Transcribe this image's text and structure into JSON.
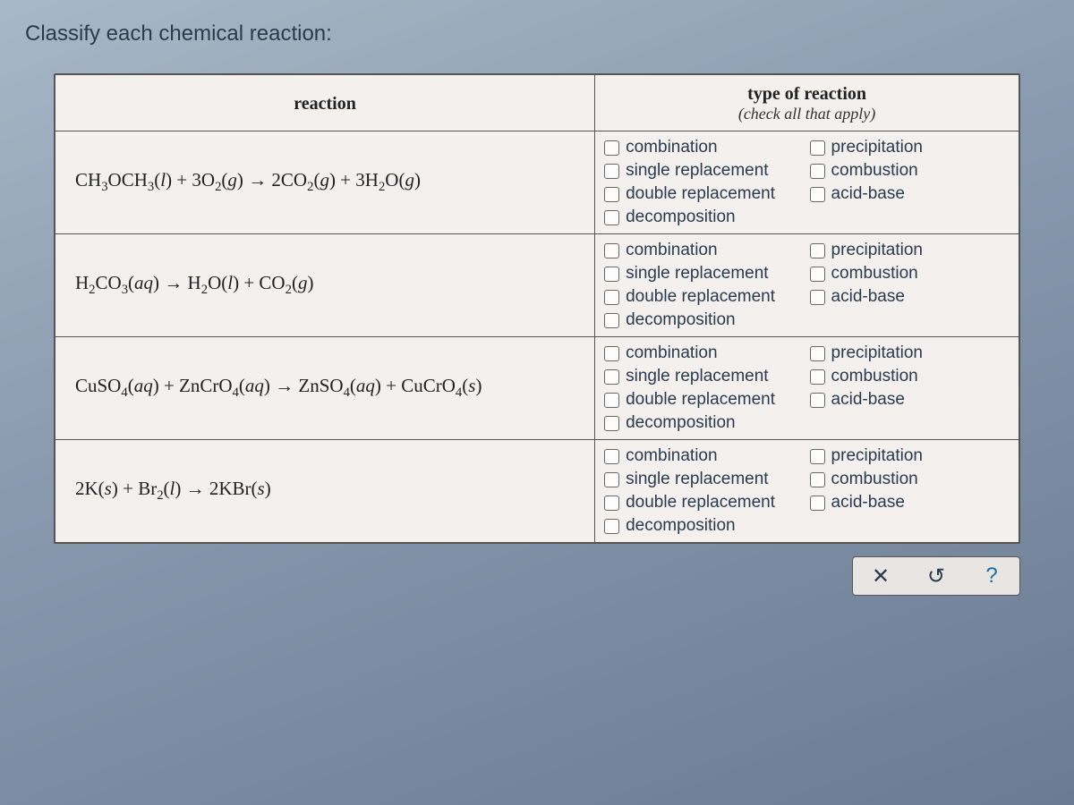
{
  "question": "Classify each chemical reaction:",
  "headers": {
    "reaction": "reaction",
    "type": "type of reaction",
    "type_sub": "(check all that apply)"
  },
  "option_labels": {
    "combination": "combination",
    "single_replacement": "single replacement",
    "double_replacement": "double replacement",
    "decomposition": "decomposition",
    "precipitation": "precipitation",
    "combustion": "combustion",
    "acid_base": "acid-base"
  },
  "rows": [
    {
      "reaction_html": "CH<sub>3</sub>OCH<sub>3</sub>(<i>l</i>) + 3O<sub>2</sub>(<i>g</i>) &rarr; 2CO<sub>2</sub>(<i>g</i>) + 3H<sub>2</sub>O(<i>g</i>)"
    },
    {
      "reaction_html": "H<sub>2</sub>CO<sub>3</sub>(<i>aq</i>) &rarr; H<sub>2</sub>O(<i>l</i>) + CO<sub>2</sub>(<i>g</i>)"
    },
    {
      "reaction_html": "CuSO<sub>4</sub>(<i>aq</i>) + ZnCrO<sub>4</sub>(<i>aq</i>) &rarr; ZnSO<sub>4</sub>(<i>aq</i>) + CuCrO<sub>4</sub>(<i>s</i>)"
    },
    {
      "reaction_html": "2K(<i>s</i>) + Br<sub>2</sub>(<i>l</i>) &rarr; 2KBr(<i>s</i>)"
    }
  ],
  "toolbar": {
    "clear": "✕",
    "reset": "↺",
    "help": "?"
  }
}
